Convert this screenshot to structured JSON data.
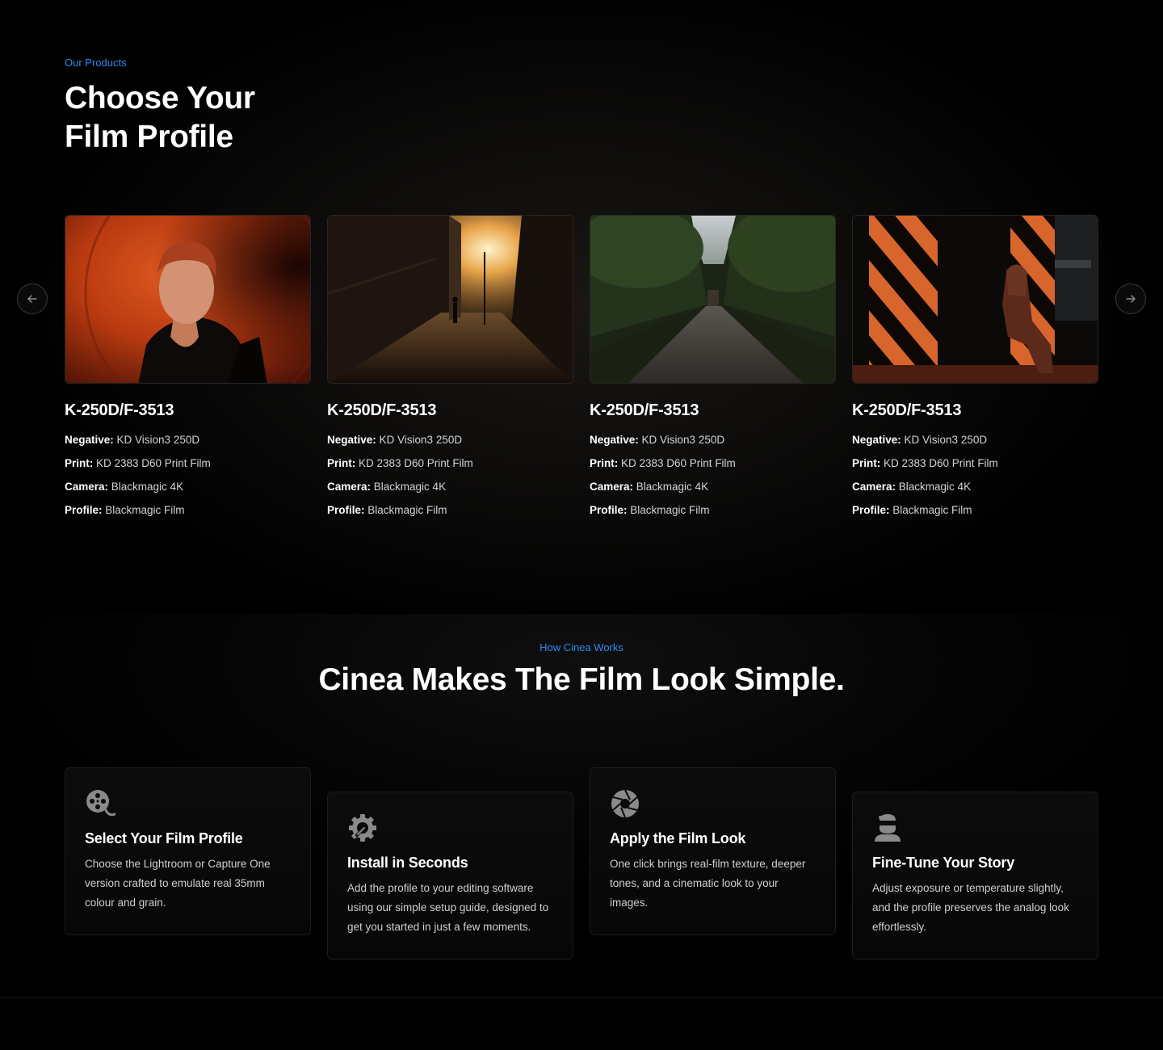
{
  "products": {
    "eyebrow": "Our Products",
    "title_line1": "Choose Your",
    "title_line2": "Film Profile",
    "cards": [
      {
        "name": "K-250D/F-3513",
        "image": "portrait-red-background",
        "specs": [
          {
            "k": "Negative:",
            "v": " KD Vision3 250D"
          },
          {
            "k": "Print:",
            "v": " KD 2383 D60 Print Film"
          },
          {
            "k": "Camera:",
            "v": " Blackmagic 4K"
          },
          {
            "k": "Profile:",
            "v": " Blackmagic Film"
          }
        ]
      },
      {
        "name": "K-250D/F-3513",
        "image": "sunset-street",
        "specs": [
          {
            "k": "Negative:",
            "v": " KD Vision3 250D"
          },
          {
            "k": "Print:",
            "v": " KD 2383 D60 Print Film"
          },
          {
            "k": "Camera:",
            "v": " Blackmagic 4K"
          },
          {
            "k": "Profile:",
            "v": " Blackmagic Film"
          }
        ]
      },
      {
        "name": "K-250D/F-3513",
        "image": "tree-lined-path",
        "specs": [
          {
            "k": "Negative:",
            "v": " KD Vision3 250D"
          },
          {
            "k": "Print:",
            "v": " KD 2383 D60 Print Film"
          },
          {
            "k": "Camera:",
            "v": " Blackmagic 4K"
          },
          {
            "k": "Profile:",
            "v": " Blackmagic Film"
          }
        ]
      },
      {
        "name": "K-250D/F-3513",
        "image": "woman-striped-pillar",
        "specs": [
          {
            "k": "Negative:",
            "v": " KD Vision3 250D"
          },
          {
            "k": "Print:",
            "v": " KD 2383 D60 Print Film"
          },
          {
            "k": "Camera:",
            "v": " Blackmagic 4K"
          },
          {
            "k": "Profile:",
            "v": " Blackmagic Film"
          }
        ]
      }
    ]
  },
  "how": {
    "eyebrow": "How Cinea Works",
    "title": "Cinea Makes The Film Look Simple.",
    "steps": [
      {
        "icon": "film-reel-icon",
        "title": "Select Your Film Profile",
        "desc": "Choose the Lightroom or Capture One version crafted to emulate real 35mm colour and grain."
      },
      {
        "icon": "gear-wrench-icon",
        "title": "Install in Seconds",
        "desc": "Add the profile to your editing software using our simple setup guide, designed to get you started in just a few moments."
      },
      {
        "icon": "aperture-icon",
        "title": "Apply the Film Look",
        "desc": "One click brings real-film texture, deeper tones, and a cinematic look to your images."
      },
      {
        "icon": "user-mask-icon",
        "title": "Fine-Tune Your Story",
        "desc": "Adjust exposure or temperature slightly, and the profile preserves the analog look effortlessly."
      }
    ]
  },
  "colors": {
    "accent": "#2d8cf0",
    "background": "#000000"
  }
}
